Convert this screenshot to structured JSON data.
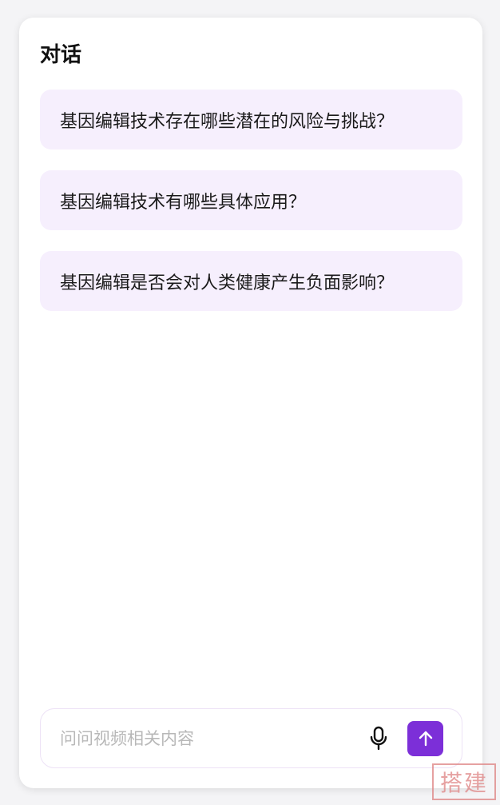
{
  "header": {
    "title": "对话"
  },
  "suggestions": [
    {
      "text": "基因编辑技术存在哪些潜在的风险与挑战？"
    },
    {
      "text": "基因编辑技术有哪些具体应用？"
    },
    {
      "text": "基因编辑是否会对人类健康产生负面影响？"
    }
  ],
  "input": {
    "placeholder": "问问视频相关内容",
    "value": ""
  },
  "icons": {
    "mic": "microphone-icon",
    "send": "arrow-up-icon"
  },
  "colors": {
    "accent": "#7c2fd8",
    "suggestion_bg": "#f6effd",
    "input_border": "#ede2f6"
  },
  "watermark": {
    "text": "搭建"
  }
}
